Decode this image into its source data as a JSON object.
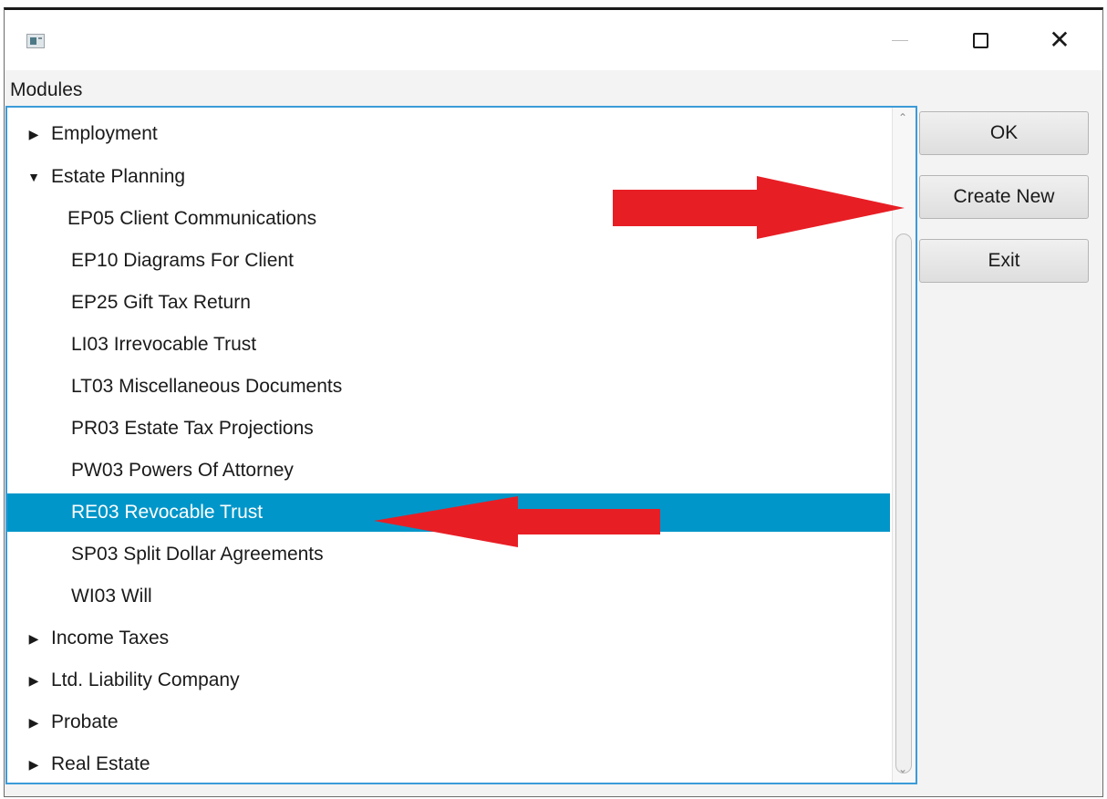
{
  "window": {
    "menu_label": "Modules",
    "close_glyph": "✕"
  },
  "tree": {
    "rows": [
      {
        "label": "Employment",
        "arrow": "▶",
        "expanded": false
      },
      {
        "label": "Estate Planning",
        "arrow": "▼",
        "expanded": true
      },
      {
        "label": "EP05 Client Communications"
      },
      {
        "label": "EP10 Diagrams For Client"
      },
      {
        "label": "EP25 Gift Tax Return"
      },
      {
        "label": "LI03 Irrevocable Trust"
      },
      {
        "label": "LT03 Miscellaneous Documents"
      },
      {
        "label": "PR03 Estate Tax Projections"
      },
      {
        "label": "PW03 Powers Of Attorney"
      },
      {
        "label": "RE03 Revocable Trust",
        "selected": true
      },
      {
        "label": "SP03 Split Dollar Agreements"
      },
      {
        "label": "WI03 Will"
      },
      {
        "label": "Income Taxes",
        "arrow": "▶",
        "expanded": false
      },
      {
        "label": "Ltd. Liability Company",
        "arrow": "▶",
        "expanded": false
      },
      {
        "label": "Probate",
        "arrow": "▶",
        "expanded": false
      },
      {
        "label": "Real Estate",
        "arrow": "▶",
        "expanded": false
      }
    ],
    "scroll_up_glyph": "⌃",
    "scroll_down_glyph": "⌄"
  },
  "buttons": {
    "ok": "OK",
    "create_new": "Create New",
    "exit": "Exit"
  },
  "colors": {
    "selection": "#0096c9",
    "annotation_arrow": "#e81e25",
    "focus_border": "#3b9bd8"
  }
}
